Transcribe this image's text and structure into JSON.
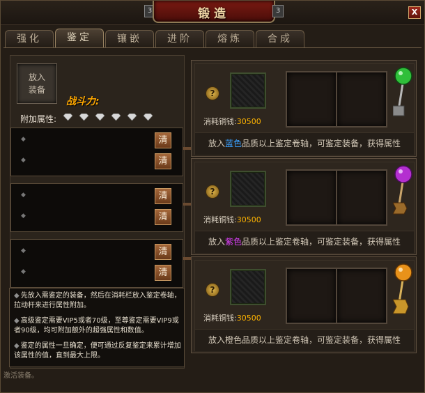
{
  "window": {
    "title": "锻造",
    "close_label": "X",
    "ornament_left": "3",
    "ornament_right": "3"
  },
  "tabs": [
    {
      "label": "强化",
      "active": false
    },
    {
      "label": "鉴定",
      "active": true
    },
    {
      "label": "镶嵌",
      "active": false
    },
    {
      "label": "进阶",
      "active": false
    },
    {
      "label": "熔炼",
      "active": false
    },
    {
      "label": "合成",
      "active": false
    }
  ],
  "left": {
    "equip_slot_label": "放入\n装备",
    "power_label": "战斗力:",
    "attr_label": "附加属性:",
    "diamonds": 6,
    "clear_label": "清",
    "help": [
      "先放入需鉴定的装备，然后在消耗栏放入鉴定卷轴，拉动杆来进行属性附加。",
      "高级鉴定需要VIP5或者70级，至尊鉴定需要VIP9或者90级，均可附加额外的超强属性和数值。",
      "鉴定的属性一旦确定，便可通过反复鉴定来累计增加该属性的值，直到最大上限。"
    ],
    "bottom_text": "激活装备。"
  },
  "panels": [
    {
      "cost_label": "消耗铜钱:",
      "cost": "30500",
      "desc_pre": "放入",
      "color_word": "蓝色",
      "desc_post": "品质以上鉴定卷轴，可鉴定装备，获得属性",
      "color": "#3aa0ff",
      "orb": "#2fbf3a"
    },
    {
      "cost_label": "消耗铜钱:",
      "cost": "30500",
      "desc_pre": "放入",
      "color_word": "紫色",
      "desc_post": "品质以上鉴定卷轴，可鉴定装备，获得属性",
      "color": "#e040ff",
      "orb": "#b42fd0"
    },
    {
      "cost_label": "消耗铜钱:",
      "cost": "30500",
      "desc_pre": "放入",
      "color_word": "橙色",
      "desc_post": "品质以上鉴定卷轴，可鉴定装备，获得属性",
      "color": "#d2c8b7",
      "orb": "#e8921a"
    }
  ]
}
